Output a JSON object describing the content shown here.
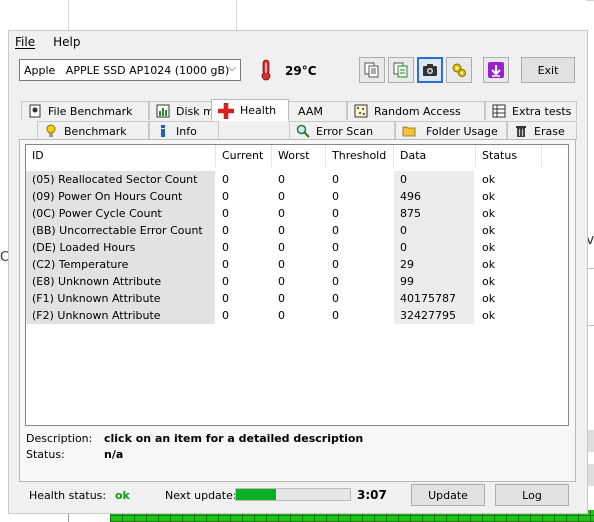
{
  "background": {
    "partial_text": "va",
    "partial_text_2": "C"
  },
  "menu": {
    "file": "File",
    "help": "Help"
  },
  "toolbar": {
    "drive_label": "Apple   APPLE SSD AP1024 (1000 gB)",
    "temperature": "29°C",
    "exit": "Exit",
    "icons": [
      "copy-text-icon",
      "copy-info-icon",
      "screenshot-camera-icon",
      "options-icon",
      "download-icon"
    ]
  },
  "tabs": {
    "top": [
      "File Benchmark",
      "Disk monitor",
      "AAM",
      "Random Access",
      "Extra tests"
    ],
    "bottom": [
      "Benchmark",
      "Info",
      "Health",
      "Error Scan",
      "Folder Usage",
      "Erase"
    ],
    "selected": "Health"
  },
  "table": {
    "headers": [
      "ID",
      "Current",
      "Worst",
      "Threshold",
      "Data",
      "Status"
    ],
    "rows": [
      [
        "(05) Reallocated Sector Count",
        "0",
        "0",
        "0",
        "0",
        "ok"
      ],
      [
        "(09) Power On Hours Count",
        "0",
        "0",
        "0",
        "496",
        "ok"
      ],
      [
        "(0C) Power Cycle Count",
        "0",
        "0",
        "0",
        "875",
        "ok"
      ],
      [
        "(BB) Uncorrectable Error Count",
        "0",
        "0",
        "0",
        "0",
        "ok"
      ],
      [
        "(DE) Loaded Hours",
        "0",
        "0",
        "0",
        "0",
        "ok"
      ],
      [
        "(C2) Temperature",
        "0",
        "0",
        "0",
        "29",
        "ok"
      ],
      [
        "(E8) Unknown Attribute",
        "0",
        "0",
        "0",
        "99",
        "ok"
      ],
      [
        "(F1) Unknown Attribute",
        "0",
        "0",
        "0",
        "40175787",
        "ok"
      ],
      [
        "(F2) Unknown Attribute",
        "0",
        "0",
        "0",
        "32427795",
        "ok"
      ]
    ]
  },
  "description": {
    "desc_label": "Description:",
    "desc_value": "click on an item for a detailed description",
    "status_label": "Status:",
    "status_value": "n/a"
  },
  "status": {
    "health_label": "Health status:",
    "health_value": "ok",
    "next_update_label": "Next update:",
    "progress_percent": 35,
    "time": "3:07",
    "update_button": "Update",
    "log_button": "Log"
  },
  "colors": {
    "ok_green": "#0a9e0a",
    "progress_green": "#06b025",
    "selected_border": "#2a6fd6"
  }
}
